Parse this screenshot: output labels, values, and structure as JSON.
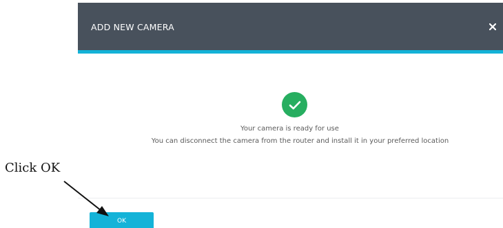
{
  "dialog": {
    "title": "ADD NEW CAMERA",
    "close_icon": "close-icon",
    "status_icon": "check-circle-icon",
    "message_line1": "Your camera is ready for use",
    "message_line2": "You can disconnect the camera from the router and install it in your preferred location",
    "ok_label": "OK"
  },
  "annotation": {
    "label": "Click OK"
  },
  "colors": {
    "header_bg": "#48515c",
    "accent": "#13b2d7",
    "success": "#27ae60",
    "ok_button": "#14b3d8"
  }
}
